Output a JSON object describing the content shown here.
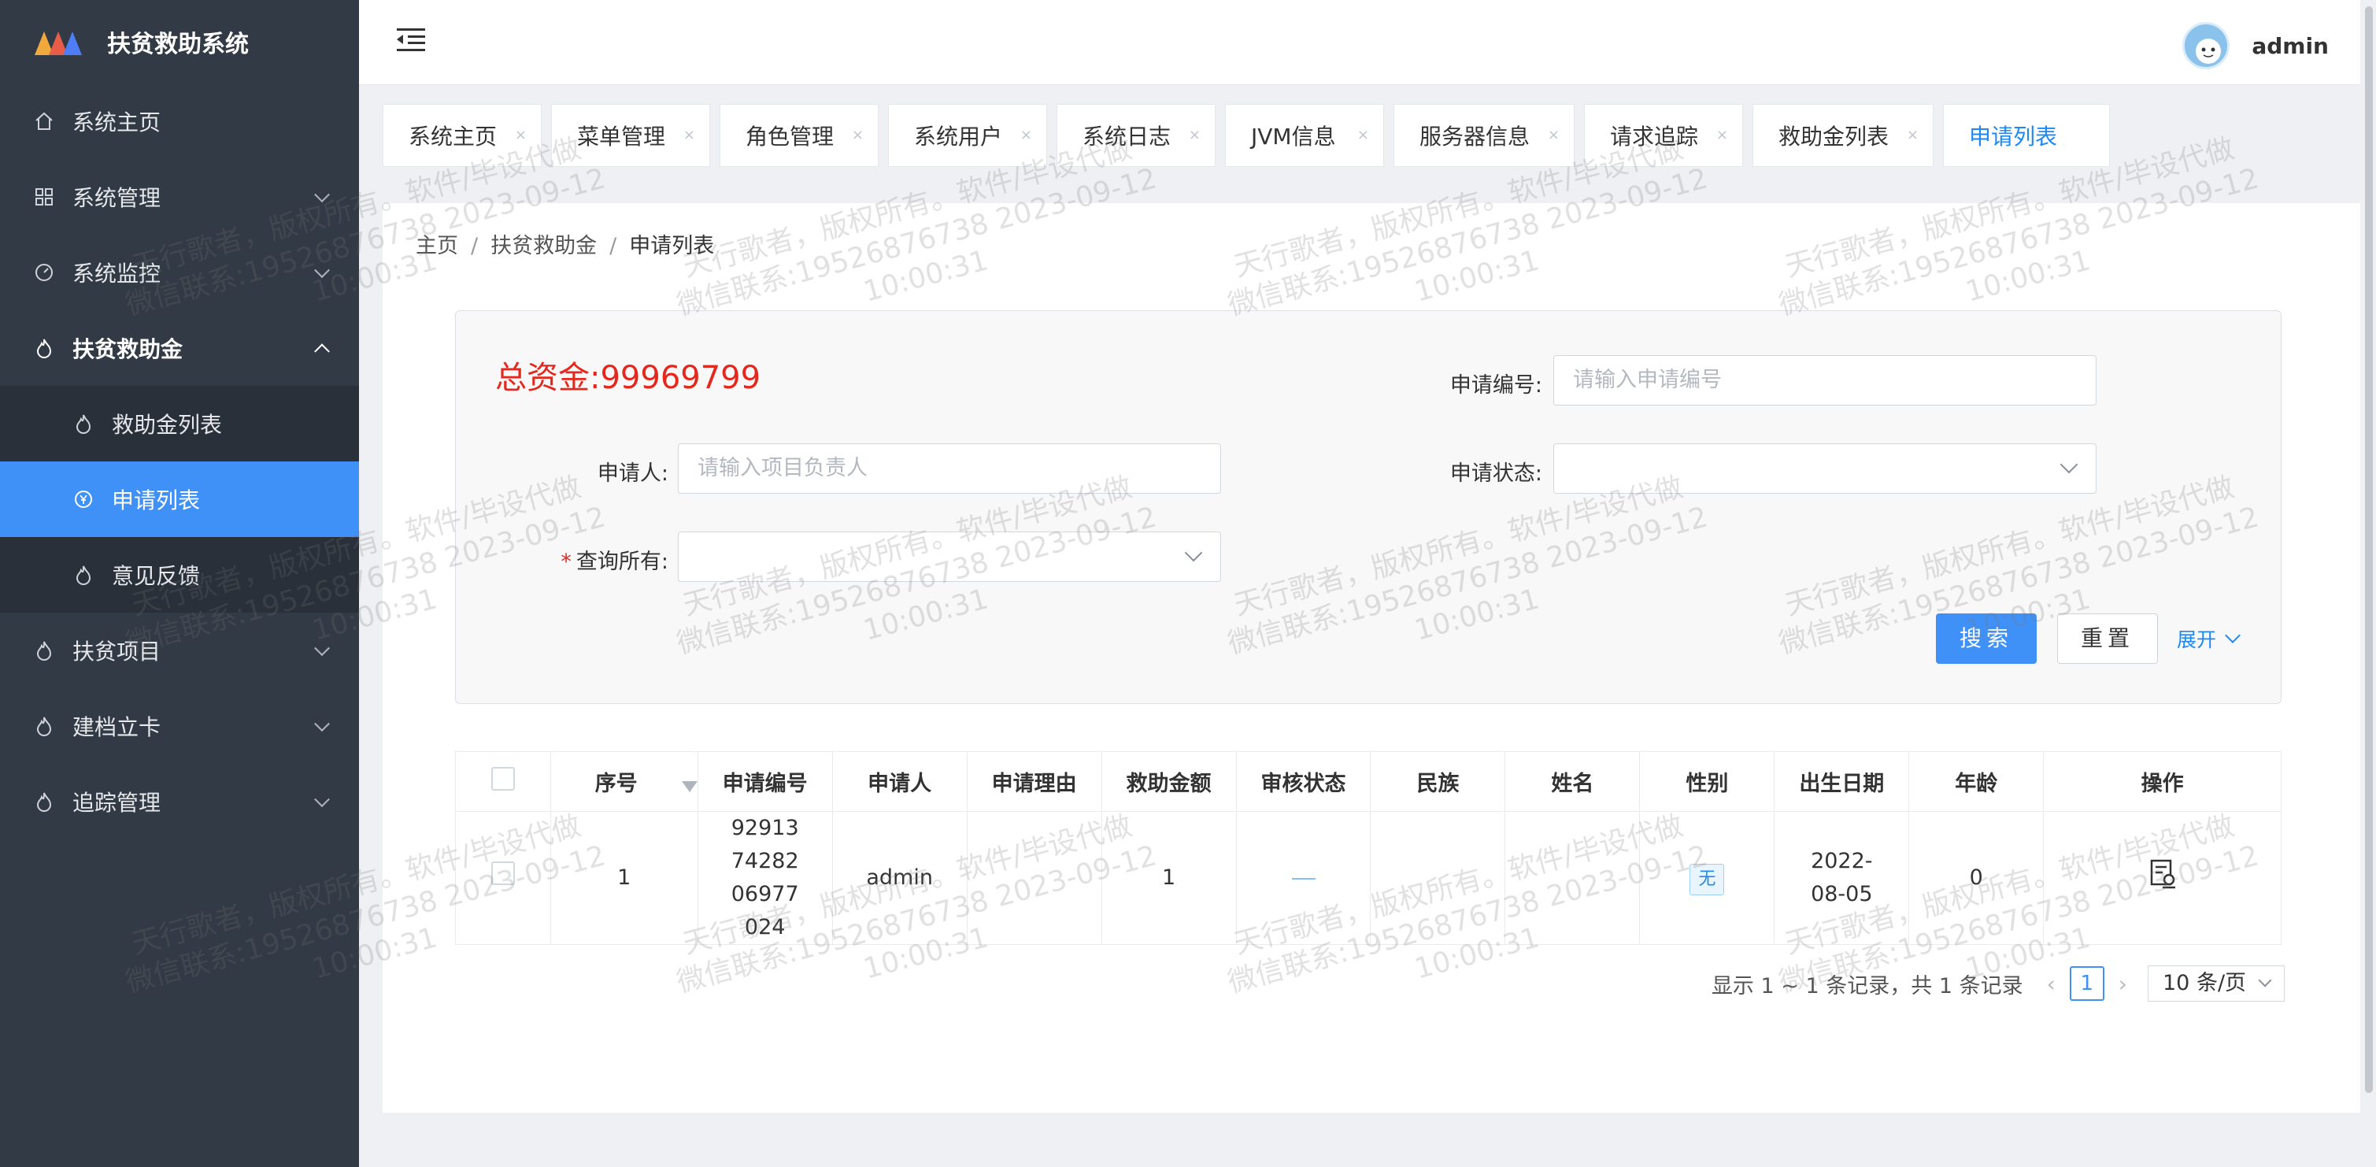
{
  "app": {
    "title": "扶贫救助系统"
  },
  "sidebar": {
    "items": [
      {
        "label": "系统主页",
        "icon": "home-icon"
      },
      {
        "label": "系统管理",
        "icon": "grid-icon"
      },
      {
        "label": "系统监控",
        "icon": "dashboard-icon"
      },
      {
        "label": "扶贫救助金",
        "icon": "flame-icon"
      },
      {
        "label": "扶贫项目",
        "icon": "flame-icon"
      },
      {
        "label": "建档立卡",
        "icon": "flame-icon"
      },
      {
        "label": "追踪管理",
        "icon": "flame-icon"
      }
    ],
    "sub": [
      {
        "label": "救助金列表",
        "icon": "flame-icon"
      },
      {
        "label": "申请列表",
        "icon": "yen-icon"
      },
      {
        "label": "意见反馈",
        "icon": "flame-icon"
      }
    ]
  },
  "header": {
    "user": "admin"
  },
  "tabs": [
    "系统主页",
    "菜单管理",
    "角色管理",
    "系统用户",
    "系统日志",
    "JVM信息",
    "服务器信息",
    "请求追踪",
    "救助金列表",
    "申请列表"
  ],
  "breadcrumb": [
    "主页",
    "扶贫救助金",
    "申请列表"
  ],
  "search": {
    "total": "总资金:99969799",
    "apply_no_label": "申请编号:",
    "apply_no_placeholder": "请输入申请编号",
    "applicant_label": "申请人:",
    "applicant_placeholder": "请输入项目负责人",
    "status_label": "申请状态:",
    "query_all_label": "查询所有:",
    "search_btn": "搜索",
    "reset_btn": "重置",
    "expand": "展开"
  },
  "table": {
    "headers": [
      "序号",
      "申请编号",
      "申请人",
      "申请理由",
      "救助金额",
      "审核状态",
      "民族",
      "姓名",
      "性别",
      "出生日期",
      "年龄",
      "操作"
    ],
    "rows": [
      {
        "index": "1",
        "apply_no": "929137428206977024",
        "applicant": "admin",
        "reason": "",
        "amount": "1",
        "status": "",
        "ethnic": "",
        "name": "",
        "sex": "无",
        "birth": "2022-08-05",
        "age": "0"
      }
    ]
  },
  "pager": {
    "summary": "显示 1 ~ 1 条记录，共 1 条记录",
    "page": "1",
    "size": "10 条/页"
  },
  "watermark": {
    "line1": "天行歌者，版权所有。软件/毕设代做",
    "line2": "微信联系:19526876738 2023-09-12",
    "line3": "10:00:31"
  }
}
